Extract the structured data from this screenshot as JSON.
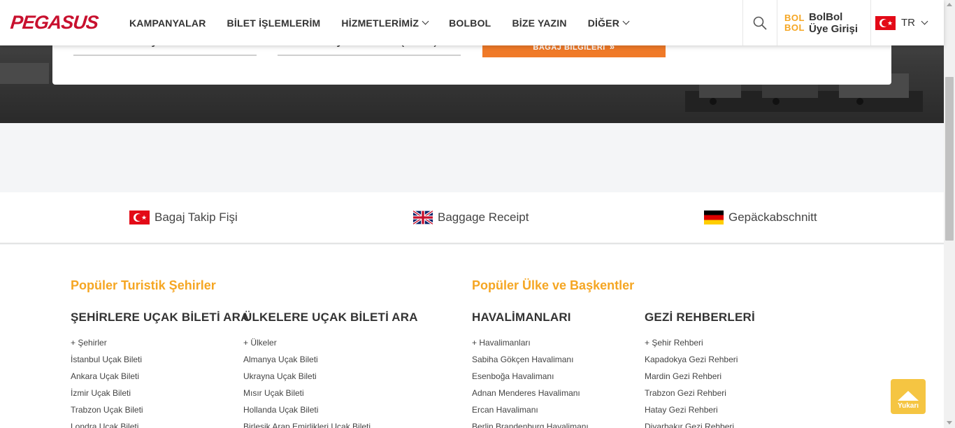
{
  "header": {
    "logo": "PEGASUS",
    "nav": [
      {
        "label": "KAMPANYALAR"
      },
      {
        "label": "BİLET İŞLEMLERİM"
      },
      {
        "label": "HİZMETLERİMİZ"
      },
      {
        "label": "BOLBOL"
      },
      {
        "label": "BİZE YAZIN"
      },
      {
        "label": "DİĞER"
      }
    ],
    "bolbol_logo_top": "BOL",
    "bolbol_logo_bottom": "BOL",
    "bolbol_line1": "BolBol",
    "bolbol_line2": "Üye Girişi",
    "lang": "TR"
  },
  "form": {
    "surname_label": "Yolcunun Soyadı",
    "pnr_label": "Rezervasyon Kodu (PNR)",
    "submit_label": "BAGAJ BİLGİLERİ"
  },
  "receipts": [
    {
      "label": "Bagaj Takip Fişi"
    },
    {
      "label": "Baggage Receipt"
    },
    {
      "label": "Gepäckabschnitt"
    }
  ],
  "footer": {
    "section_left": "Popüler Turistik Şehirler",
    "section_right": "Popüler Ülke ve Başkentler",
    "columns": [
      {
        "title": "ŞEHİRLERE UÇAK BİLETİ ARA",
        "links": [
          "+ Şehirler",
          "İstanbul Uçak Bileti",
          "Ankara Uçak Bileti",
          "İzmir Uçak Bileti",
          "Trabzon Uçak Bileti",
          "Londra Uçak Bileti"
        ]
      },
      {
        "title": "ÜLKELERE UÇAK BİLETİ ARA",
        "links": [
          "+ Ülkeler",
          "Almanya Uçak Bileti",
          "Ukrayna Uçak Bileti",
          "Mısır Uçak Bileti",
          "Hollanda Uçak Bileti",
          "Birleşik Arap Emirlikleri Uçak Bileti"
        ]
      },
      {
        "title": "HAVALİMANLARI",
        "links": [
          "+ Havalimanları",
          "Sabiha Gökçen Havalimanı",
          "Esenboğa Havalimanı",
          "Adnan Menderes Havalimanı",
          "Ercan Havalimanı",
          "Berlin Brandenburg Havalimanı"
        ]
      },
      {
        "title": "GEZİ REHBERLERİ",
        "links": [
          "+ Şehir Rehberi",
          "Kapadokya Gezi Rehberi",
          "Mardin Gezi Rehberi",
          "Trabzon Gezi Rehberi",
          "Hatay Gezi Rehberi",
          "Diyarbakır Gezi Rehberi"
        ]
      }
    ]
  },
  "up_button": {
    "label": "Yukarı"
  },
  "colors": {
    "brand_red": "#c8102e",
    "accent_orange": "#f07a28",
    "accent_yellow": "#f5a623"
  }
}
